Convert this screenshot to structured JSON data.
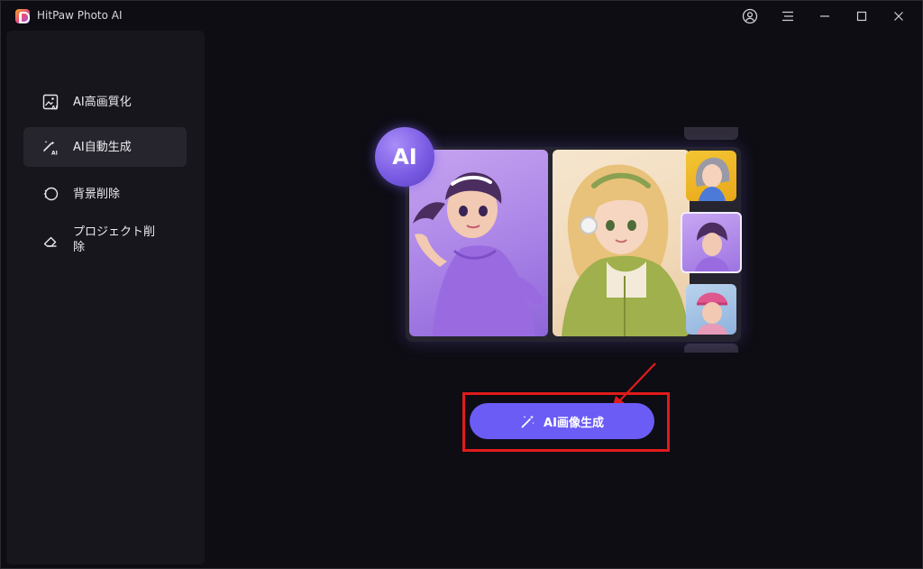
{
  "app": {
    "title": "HitPaw Photo AI"
  },
  "titlebar": {
    "icons": [
      "account-icon",
      "menu-icon",
      "minimize-icon",
      "maximize-icon",
      "close-icon"
    ]
  },
  "sidebar": {
    "items": [
      {
        "label": "AI高画質化",
        "icon": "image-enhance-icon",
        "active": false
      },
      {
        "label": "AI自動生成",
        "icon": "magic-wand-ai-icon",
        "active": true
      },
      {
        "label": "背景削除",
        "icon": "background-remove-icon",
        "active": false
      },
      {
        "label": "プロジェクト削除",
        "label_line1": "プロジェクト削",
        "label_line2": "除",
        "icon": "eraser-icon",
        "active": false
      }
    ]
  },
  "hero": {
    "badge_text": "AI"
  },
  "main": {
    "cta_label": "AI画像生成",
    "cta_icon": "magic-wand-icon"
  },
  "colors": {
    "accent": "#6b5cf6",
    "highlight_border": "#e11b1b",
    "background": "#0e0d14",
    "sidebar": "#17161d"
  }
}
